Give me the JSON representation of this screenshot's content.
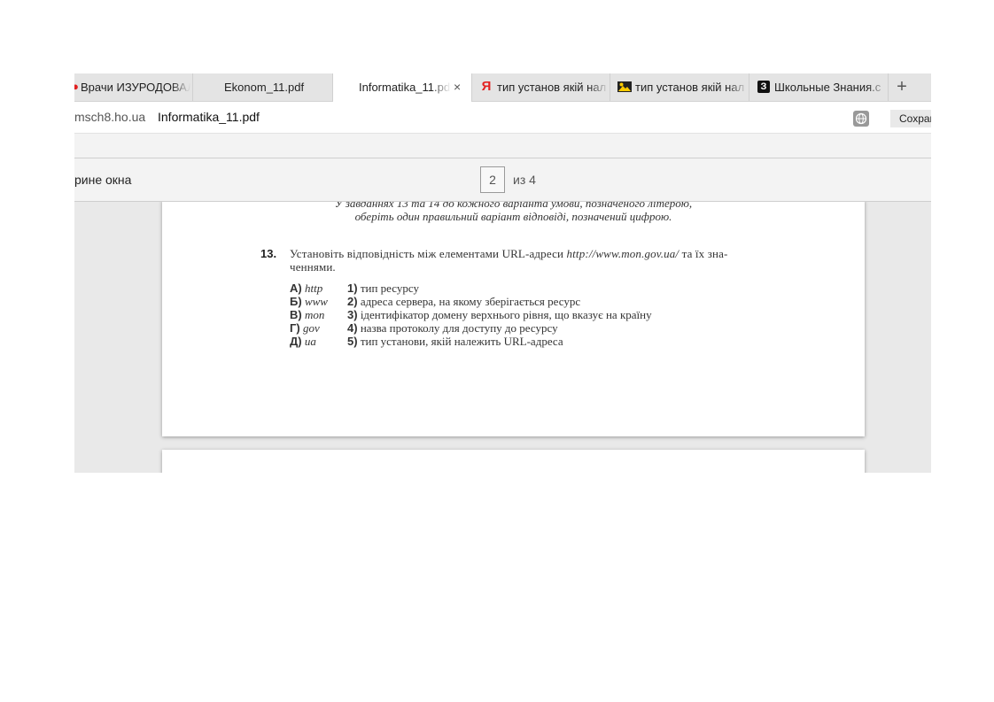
{
  "tabs": [
    {
      "favicon": "red-circle-icon",
      "title": "Врачи ИЗУРОДОВАЛ"
    },
    {
      "favicon": "",
      "title": "Ekonom_11.pdf"
    },
    {
      "favicon": "",
      "title": "Informatika_11.pdf",
      "active": true
    },
    {
      "favicon": "yandex-icon",
      "favicon_glyph": "Я",
      "title": "тип установ якій нал"
    },
    {
      "favicon": "image-icon",
      "title": "тип установ якій нал"
    },
    {
      "favicon": "znanija-icon",
      "favicon_glyph": "З",
      "title": "Школьные Знания.c"
    }
  ],
  "new_tab_symbol": "+",
  "close_symbol": "×",
  "address": {
    "domain": "msch8.ho.ua",
    "title": "Informatika_11.pdf",
    "save_label": "Сохран"
  },
  "pdf_toolbar": {
    "fit_label": "рине окна",
    "page_current": "2",
    "page_of": "из 4"
  },
  "document": {
    "instruction_line1": "У завданнях 13 та 14 до кожного варіанта умови, позначеного літерою,",
    "instruction_line2": "оберіть один правильний варіант відповіді, позначений цифрою.",
    "question_number": "13.",
    "question_text_part1": "Установіть відповідність між елементами URL-адреси",
    "question_url": "http://www.mon.gov.ua/",
    "question_text_part2": "та їх зна-",
    "question_text_line2": "ченнями.",
    "options": [
      {
        "letter": "А)",
        "term": "http"
      },
      {
        "letter": "Б)",
        "term": "www"
      },
      {
        "letter": "В)",
        "term": "mon"
      },
      {
        "letter": "Г)",
        "term": "gov"
      },
      {
        "letter": "Д)",
        "term": "ua"
      }
    ],
    "answers": [
      {
        "num": "1)",
        "text": "тип ресурсу"
      },
      {
        "num": "2)",
        "text": "адреса сервера, на якому зберігається ресурс"
      },
      {
        "num": "3)",
        "text": "ідентифікатор домену верхнього рівня, що вказує на країну"
      },
      {
        "num": "4)",
        "text": "назва протоколу для доступу до ресурсу"
      },
      {
        "num": "5)",
        "text": "тип установи, якій належить URL-адреса"
      }
    ]
  },
  "colors": {
    "tabstrip_bg": "#e4e4e4",
    "active_tab_bg": "#ffffff",
    "yandex_red": "#e32222",
    "pdf_bg": "#e9e9e9"
  }
}
